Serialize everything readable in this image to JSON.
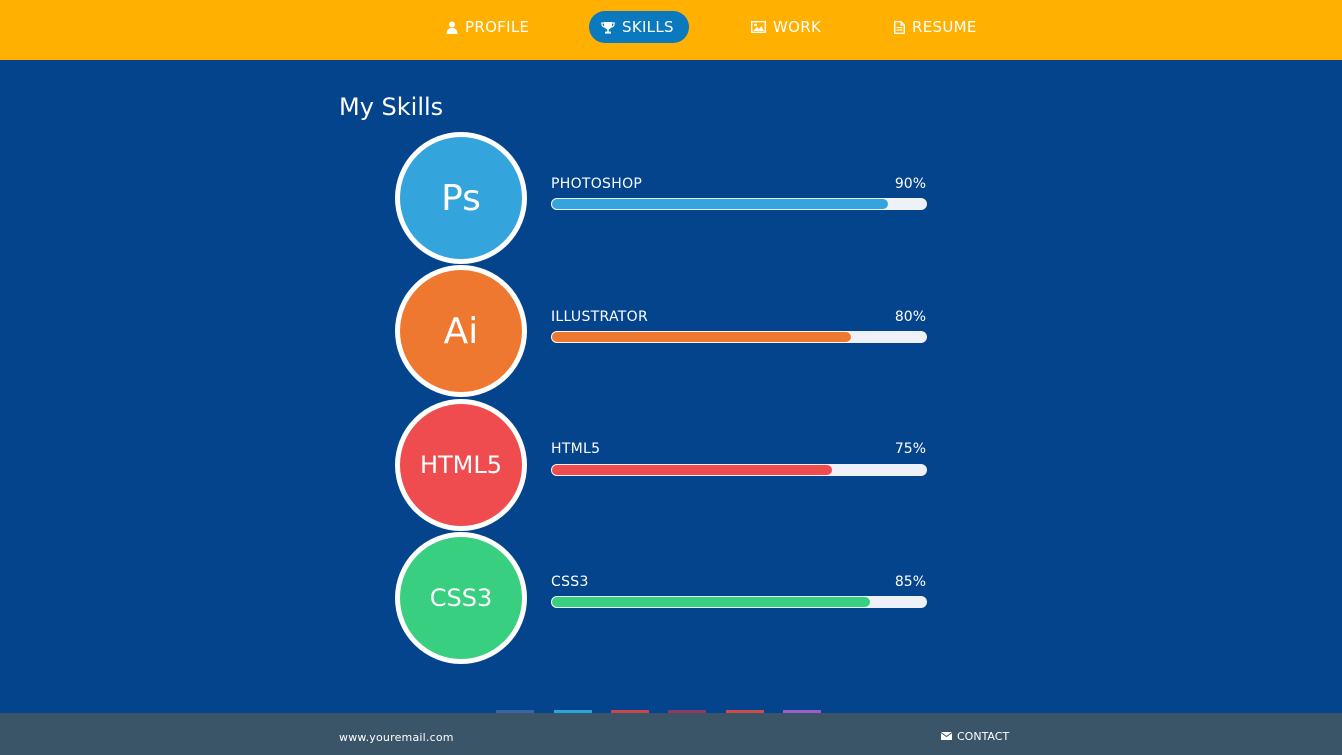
{
  "nav": {
    "items": [
      {
        "label": "PROFILE",
        "icon": "user-icon",
        "active": false
      },
      {
        "label": "SKILLS",
        "icon": "trophy-icon",
        "active": true
      },
      {
        "label": "WORK",
        "icon": "image-icon",
        "active": false
      },
      {
        "label": "RESUME",
        "icon": "document-icon",
        "active": false
      }
    ]
  },
  "colors": {
    "topbar": "#ffb000",
    "background": "#04448c",
    "active_tab": "#0a79bd",
    "footer": "#3b5568",
    "track": "#eef1f7"
  },
  "section": {
    "title": "My Skills"
  },
  "skills": [
    {
      "badge": "Ps",
      "name": "PHOTOSHOP",
      "percent_label": "90%",
      "level": 0.9,
      "color": "#34a4dc"
    },
    {
      "badge": "Ai",
      "name": "ILLUSTRATOR",
      "percent_label": "80%",
      "level": 0.8,
      "color": "#ef7830"
    },
    {
      "badge": "HTML5",
      "name": "HTML5",
      "percent_label": "75%",
      "level": 0.75,
      "color": "#ee4c4e"
    },
    {
      "badge": "CSS3",
      "name": "CSS3",
      "percent_label": "85%",
      "level": 0.85,
      "color": "#38cf80"
    }
  ],
  "social_colors": [
    "#3b64a8",
    "#29a6e2",
    "#c8474c",
    "#8e3a5e",
    "#cc4b4b",
    "#9a5fc6"
  ],
  "footer": {
    "email": "www.youremail.com",
    "contact_label": "CONTACT",
    "contact_icon": "mail-icon"
  }
}
